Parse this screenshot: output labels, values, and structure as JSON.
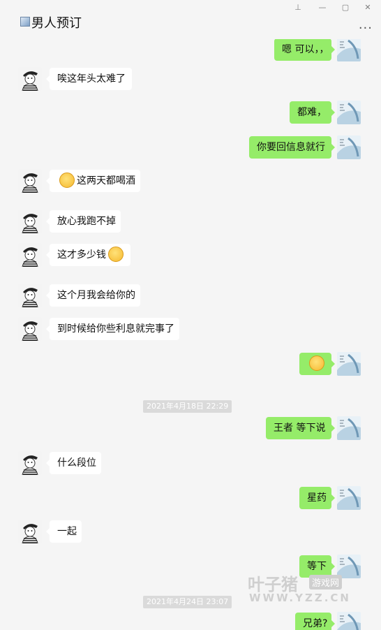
{
  "window": {
    "title": "男人预订",
    "controls": {
      "pin": "⊥",
      "minimize": "—",
      "maximize": "▢",
      "close": "✕"
    },
    "more": "···"
  },
  "messages": [
    {
      "dir": "out",
      "text": "嗯 可以，，",
      "top": 0,
      "partial": true
    },
    {
      "dir": "in",
      "text": "唉这年头太难了"
    },
    {
      "dir": "out",
      "text": "都难，"
    },
    {
      "dir": "out",
      "text": "你要回信息就行"
    },
    {
      "dir": "in",
      "text": "这两天都喝酒",
      "emoji_before": "emoji-face"
    },
    {
      "dir": "in",
      "text": "放心我跑不掉"
    },
    {
      "dir": "in",
      "text": "这才多少钱",
      "emoji_after": "emoji-face"
    },
    {
      "dir": "in",
      "text": "这个月我会给你的"
    },
    {
      "dir": "in",
      "text": "到时候给你些利息就完事了"
    },
    {
      "dir": "out",
      "text": "",
      "emoji_only": "emoji-face"
    },
    {
      "timestamp": "2021年4月18日 22:29"
    },
    {
      "dir": "out",
      "text": "王者 等下说"
    },
    {
      "dir": "in",
      "text": "什么段位"
    },
    {
      "dir": "out",
      "text": "星药"
    },
    {
      "dir": "in",
      "text": "一起"
    },
    {
      "dir": "out",
      "text": "等下"
    },
    {
      "timestamp": "2021年4月24日 23:07"
    },
    {
      "dir": "out",
      "text": "兄弟?"
    }
  ],
  "watermark": {
    "name": "叶子猪",
    "tag": "游戏网",
    "url": "WWW.YZZ.CN"
  },
  "colors": {
    "outgoing": "#95ec69",
    "incoming": "#ffffff",
    "background": "#f5f5f5"
  }
}
